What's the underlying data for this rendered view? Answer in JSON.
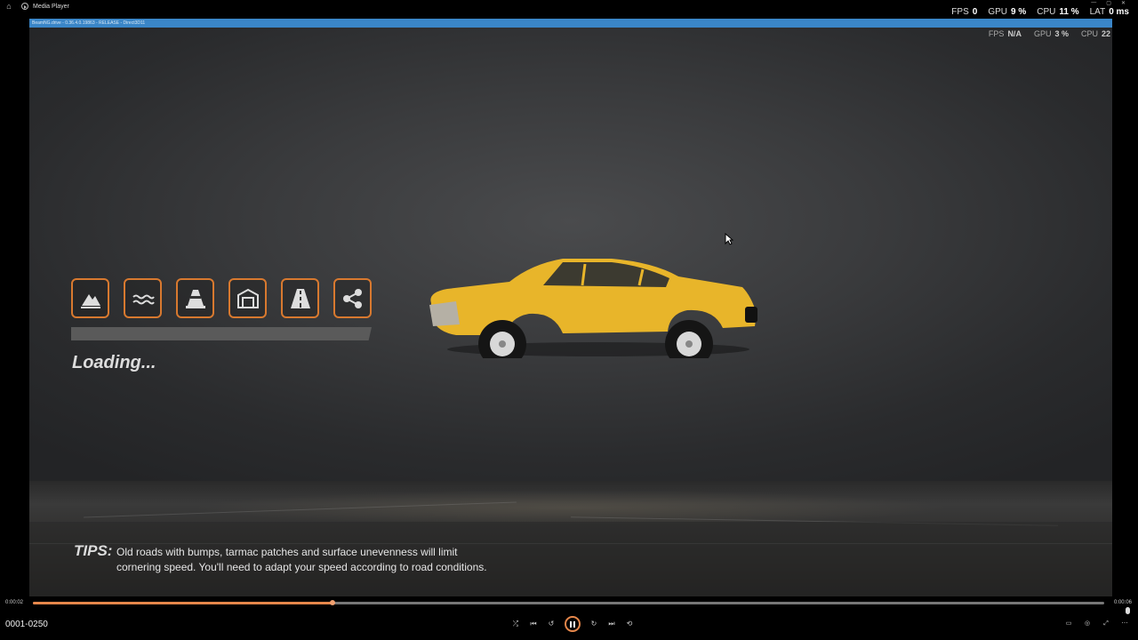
{
  "window": {
    "title": "Media Player"
  },
  "perf_outer": [
    {
      "label": "FPS",
      "value": "0"
    },
    {
      "label": "GPU",
      "value": "9 %"
    },
    {
      "label": "CPU",
      "value": "11 %"
    },
    {
      "label": "LAT",
      "value": "0 ms"
    }
  ],
  "game": {
    "build_label": "BeamNG.drive - 0.36.4.0.19863 - RELEASE - Direct3D11",
    "perf_inner": [
      {
        "label": "FPS",
        "value": "N/A"
      },
      {
        "label": "GPU",
        "value": "3 %"
      },
      {
        "label": "CPU",
        "value": "22"
      }
    ],
    "loading_text": "Loading...",
    "loading_progress": 0,
    "icons": [
      "terrain-icon",
      "water-icon",
      "traffic-cone-icon",
      "garage-icon",
      "road-icon",
      "network-icon"
    ],
    "tips_label": "TIPS:",
    "tips_text": "Old roads with bumps, tarmac patches and surface unevenness will limit cornering speed. You'll need to adapt your speed according to road conditions."
  },
  "player": {
    "current_time": "0:00:02",
    "total_time": "0:00:06",
    "seek_fraction": 0.28,
    "frame_counter": "0001-0250"
  },
  "colors": {
    "accent": "#d8792f",
    "seek": "#e6874b",
    "titlebar_blue": "#3a86c8",
    "car": "#e8b52a"
  }
}
